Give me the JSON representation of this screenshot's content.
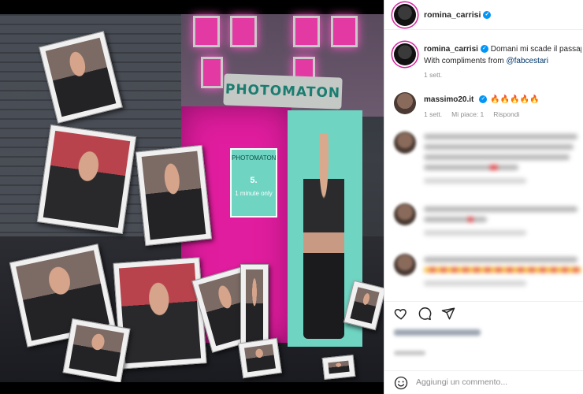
{
  "post": {
    "image_alt": "post-image",
    "booth_sign": "PHOTOMATON",
    "booth_card": {
      "title": "PHOTOMATON",
      "price": "5.",
      "duration": "1 minute only"
    }
  },
  "header": {
    "username": "romina_carrisi",
    "verified": true
  },
  "caption": {
    "username": "romina_carrisi",
    "line1": "Domani mi scade il passap",
    "line2_prefix": "With compliments from ",
    "mention": "@fabcestari",
    "time": "1 sett."
  },
  "comments": [
    {
      "username": "massimo20.it",
      "text": "🔥🔥🔥🔥🔥",
      "time": "1 sett.",
      "likes": "Mi piace: 1",
      "reply": "Rispondi"
    }
  ],
  "actions": {
    "like": "heart-icon",
    "comment": "comment-icon",
    "share": "send-icon"
  },
  "add_comment": {
    "placeholder": "Aggiungi un commento..."
  },
  "colors": {
    "verified": "#0095f6",
    "story_ring": "#d6249f",
    "mention": "#00376b",
    "booth": "#e01d9e"
  }
}
